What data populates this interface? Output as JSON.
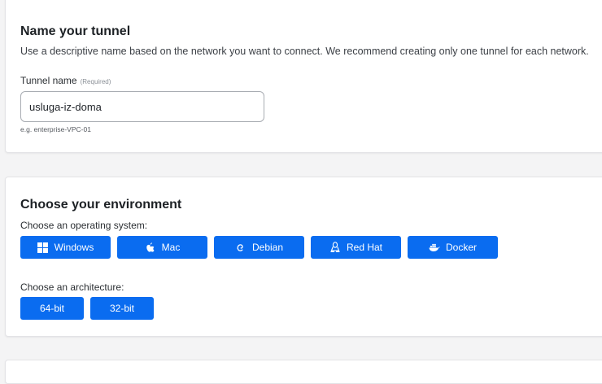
{
  "name_section": {
    "title": "Name your tunnel",
    "description": "Use a descriptive name based on the network you want to connect. We recommend creating only one tunnel for each network.",
    "field_label": "Tunnel name",
    "required_tag": "(Required)",
    "input_value": "usluga-iz-doma",
    "hint": "e.g. enterprise-VPC-01"
  },
  "environment_section": {
    "title": "Choose your environment",
    "os_label": "Choose an operating system:",
    "os_options": [
      {
        "label": "Windows",
        "icon": "windows-icon"
      },
      {
        "label": "Mac",
        "icon": "apple-icon"
      },
      {
        "label": "Debian",
        "icon": "debian-icon"
      },
      {
        "label": "Red Hat",
        "icon": "linux-icon"
      },
      {
        "label": "Docker",
        "icon": "docker-icon"
      }
    ],
    "arch_label": "Choose an architecture:",
    "arch_options": [
      {
        "label": "64-bit"
      },
      {
        "label": "32-bit"
      }
    ]
  },
  "colors": {
    "accent": "#0a6cf0",
    "card_background": "#ffffff",
    "page_background": "#f4f4f5"
  }
}
